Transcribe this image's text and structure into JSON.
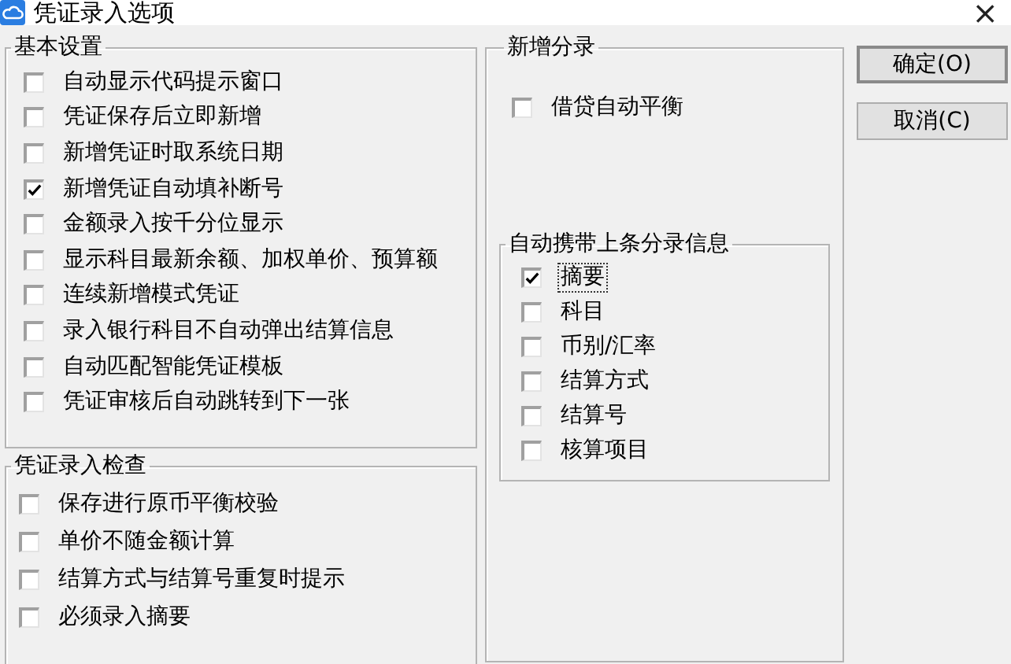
{
  "window": {
    "title": "凭证录入选项",
    "close": "×"
  },
  "basic_settings": {
    "title": "基本设置",
    "items": [
      {
        "label": "自动显示代码提示窗口",
        "checked": false
      },
      {
        "label": "凭证保存后立即新增",
        "checked": false
      },
      {
        "label": "新增凭证时取系统日期",
        "checked": false
      },
      {
        "label": "新增凭证自动填补断号",
        "checked": true
      },
      {
        "label": "金额录入按千分位显示",
        "checked": false
      },
      {
        "label": "显示科目最新余额、加权单价、预算额",
        "checked": false
      },
      {
        "label": "连续新增模式凭证",
        "checked": false
      },
      {
        "label": "录入银行科目不自动弹出结算信息",
        "checked": false
      },
      {
        "label": "自动匹配智能凭证模板",
        "checked": false
      },
      {
        "label": "凭证审核后自动跳转到下一张",
        "checked": false
      }
    ]
  },
  "entry_check": {
    "title": "凭证录入检查",
    "items": [
      {
        "label": "保存进行原币平衡校验",
        "checked": false
      },
      {
        "label": "单价不随金额计算",
        "checked": false
      },
      {
        "label": "结算方式与结算号重复时提示",
        "checked": false
      },
      {
        "label": "必须录入摘要",
        "checked": false
      }
    ]
  },
  "new_entry": {
    "title": "新增分录",
    "items": [
      {
        "label": "借贷自动平衡",
        "checked": false
      }
    ],
    "carry_over": {
      "title": "自动携带上条分录信息",
      "items": [
        {
          "label": "摘要",
          "checked": true,
          "focused": true
        },
        {
          "label": "科目",
          "checked": false,
          "focused": false
        },
        {
          "label": "币别/汇率",
          "checked": false,
          "focused": false
        },
        {
          "label": "结算方式",
          "checked": false,
          "focused": false
        },
        {
          "label": "结算号",
          "checked": false,
          "focused": false
        },
        {
          "label": "核算项目",
          "checked": false,
          "focused": false
        }
      ]
    }
  },
  "buttons": [
    {
      "label": "确定(O)",
      "default": true
    },
    {
      "label": "取消(C)",
      "default": false
    }
  ]
}
